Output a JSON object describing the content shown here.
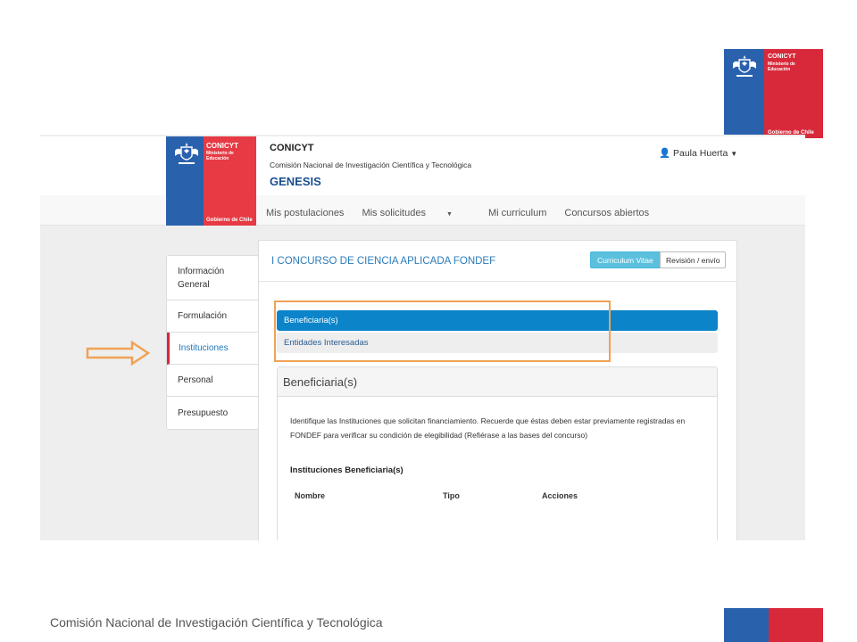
{
  "colors": {
    "gov_blue": "#2a61ad",
    "gov_red": "#d8293a",
    "accent": "#0b84c9",
    "annotation": "#f0a256"
  },
  "top_logo": {
    "name": "CONICYT",
    "ministry": "Ministerio de Educación",
    "gov": "Gobierno de Chile"
  },
  "header": {
    "logo": {
      "name": "CONICYT",
      "ministry": "Ministerio de Educación",
      "gov": "Gobierno de Chile"
    },
    "brand_title": "CONICYT",
    "brand_subtitle": "Comisión Nacional de Investigación Científica y Tecnológica",
    "app_name": "GENESIS",
    "user": {
      "icon": "user-icon",
      "name": "Paula Huerta"
    },
    "nav": [
      "Mis postulaciones",
      "Mis solicitudes",
      "Mi curriculum",
      "Concursos abiertos"
    ]
  },
  "sidebar": {
    "items": [
      {
        "label": "Información General",
        "active": false
      },
      {
        "label": "Formulación",
        "active": false
      },
      {
        "label": "Instituciones",
        "active": true
      },
      {
        "label": "Personal",
        "active": false
      },
      {
        "label": "Presupuesto",
        "active": false
      }
    ]
  },
  "main": {
    "title": "I CONCURSO DE CIENCIA APLICADA FONDEF",
    "buttons": {
      "cv": "Curriculum Vitae",
      "review": "Revisión / envío"
    },
    "tabs": [
      "Beneficiaria(s)",
      "Entidades Interesadas"
    ],
    "section": {
      "heading": "Beneficiaria(s)",
      "description": "Identifique las Instituciones que solicitan financiamiento. Recuerde que éstas deben estar previamente registradas en FONDEF para verificar su condición de elegibilidad (Refiérase a las bases del concurso)",
      "subheading": "Instituciones Beneficiaria(s)",
      "table_headers": [
        "Nombre",
        "Tipo",
        "Acciones"
      ]
    }
  },
  "footer": {
    "text": "Comisión Nacional de Investigación Científica y Tecnológica"
  }
}
